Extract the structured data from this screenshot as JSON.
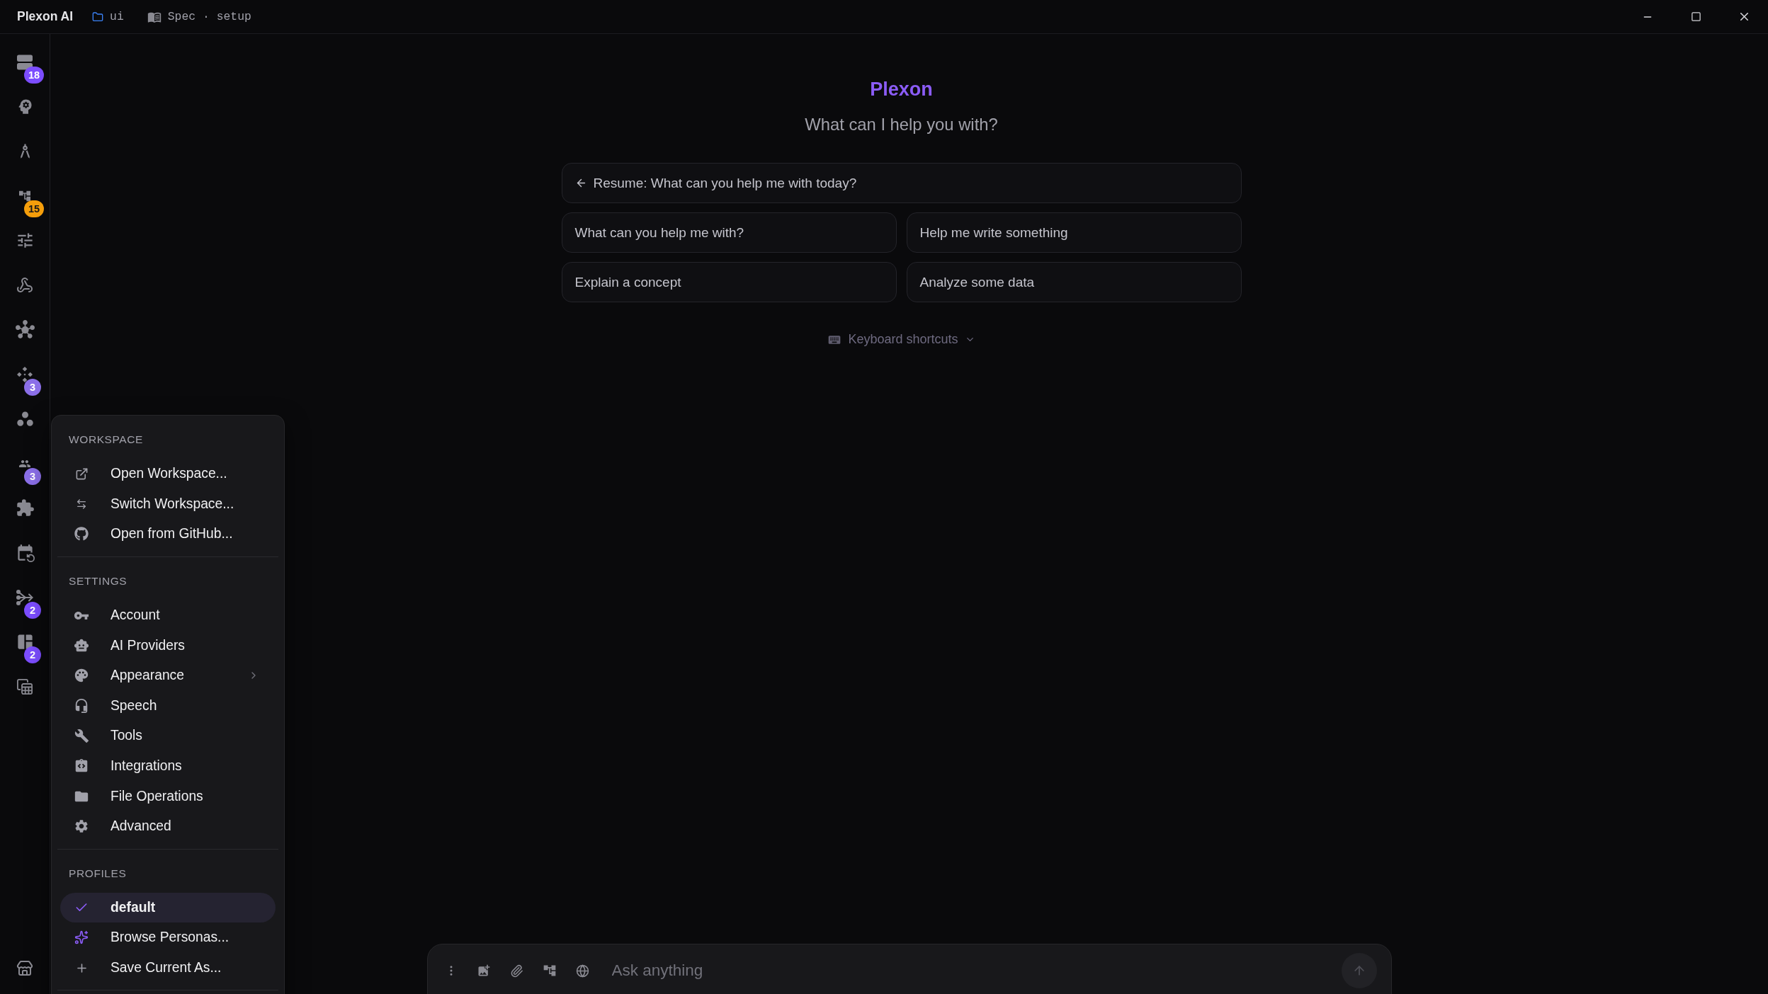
{
  "title_bar": {
    "app_name": "Plexon AI",
    "folder": "ui",
    "document": "Spec · setup"
  },
  "sidebar": {
    "badges": [
      {
        "count": "18",
        "color": "#7c4dff"
      },
      {
        "count": "15",
        "color": "#f59e0b"
      },
      {
        "count": "3",
        "color": "#8b6fe8"
      },
      {
        "count": "3",
        "color": "#8b6fe8"
      },
      {
        "count": "2",
        "color": "#7c4dff"
      },
      {
        "count": "2",
        "color": "#7c4dff"
      }
    ]
  },
  "home": {
    "title": "Plexon",
    "subtitle": "What can I help you with?",
    "resume": "Resume: What can you help me with today?",
    "suggestions": [
      "What can you help me with?",
      "Help me write something",
      "Explain a concept",
      "Analyze some data"
    ],
    "shortcuts": {
      "label": "Keyboard shortcuts",
      "expanded": false
    }
  },
  "menu": {
    "sections": [
      {
        "heading": "WORKSPACE",
        "items": [
          {
            "label": "Open Workspace...",
            "submenu": false
          },
          {
            "label": "Switch Workspace...",
            "submenu": false
          },
          {
            "label": "Open from GitHub...",
            "submenu": false
          }
        ]
      },
      {
        "heading": "SETTINGS",
        "items": [
          {
            "label": "Account",
            "submenu": false
          },
          {
            "label": "AI Providers",
            "submenu": false
          },
          {
            "label": "Appearance",
            "submenu": true
          },
          {
            "label": "Speech",
            "submenu": false
          },
          {
            "label": "Tools",
            "submenu": false
          },
          {
            "label": "Integrations",
            "submenu": false
          },
          {
            "label": "File Operations",
            "submenu": false
          },
          {
            "label": "Advanced",
            "submenu": false
          }
        ]
      },
      {
        "heading": "PROFILES",
        "items": [
          {
            "label": "default",
            "selected": true
          },
          {
            "label": "Browse Personas...",
            "selected": false
          },
          {
            "label": "Save Current As...",
            "selected": false
          }
        ]
      }
    ]
  },
  "composer": {
    "placeholder": "Ask anything"
  }
}
